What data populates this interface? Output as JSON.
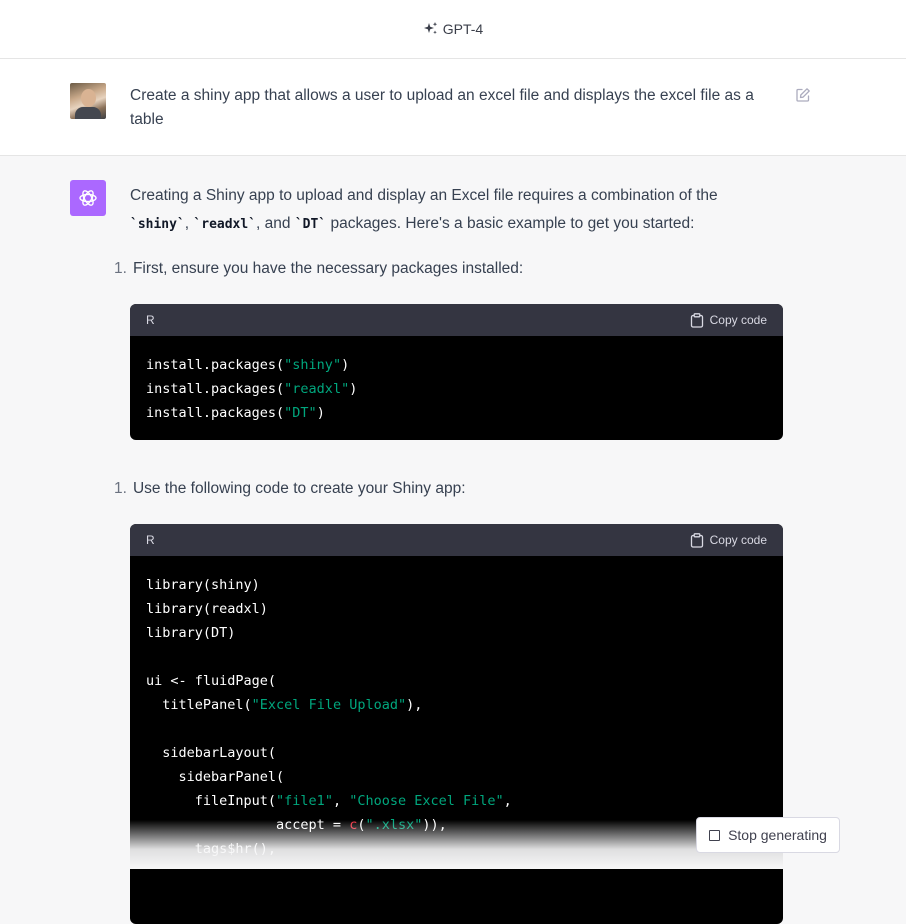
{
  "header": {
    "model_label": "GPT-4",
    "spark_icon": "sparkles-icon"
  },
  "user_message": {
    "text": "Create a shiny app that allows a user to upload an excel file and displays the excel file as a table",
    "edit_icon": "edit-icon"
  },
  "assistant": {
    "intro_line1": "Creating a Shiny app to upload and display an Excel file requires a combination of the",
    "pkg1": "`shiny`",
    "sep1": ", ",
    "pkg2": "`readxl`",
    "sep2": ", and ",
    "pkg3": "`DT`",
    "intro_tail": " packages. Here's a basic example to get you started:",
    "steps": [
      {
        "number": "1.",
        "text": "First, ensure you have the necessary packages installed:"
      },
      {
        "number": "1.",
        "text": "Use the following code to create your Shiny app:"
      }
    ],
    "code_blocks": [
      {
        "language": "R",
        "copy_label": "Copy code",
        "lines": [
          [
            {
              "t": "install.packages(",
              "c": "plain"
            },
            {
              "t": "\"shiny\"",
              "c": "str"
            },
            {
              "t": ")",
              "c": "plain"
            }
          ],
          [
            {
              "t": "install.packages(",
              "c": "plain"
            },
            {
              "t": "\"readxl\"",
              "c": "str"
            },
            {
              "t": ")",
              "c": "plain"
            }
          ],
          [
            {
              "t": "install.packages(",
              "c": "plain"
            },
            {
              "t": "\"DT\"",
              "c": "str"
            },
            {
              "t": ")",
              "c": "plain"
            }
          ]
        ]
      },
      {
        "language": "R",
        "copy_label": "Copy code",
        "lines": [
          [
            {
              "t": "library(shiny)",
              "c": "plain"
            }
          ],
          [
            {
              "t": "library(readxl)",
              "c": "plain"
            }
          ],
          [
            {
              "t": "library(DT)",
              "c": "plain"
            }
          ],
          [
            {
              "t": "",
              "c": "plain"
            }
          ],
          [
            {
              "t": "ui <- fluidPage(",
              "c": "plain"
            }
          ],
          [
            {
              "t": "  titlePanel(",
              "c": "plain"
            },
            {
              "t": "\"Excel File Upload\"",
              "c": "str"
            },
            {
              "t": "),",
              "c": "plain"
            }
          ],
          [
            {
              "t": "",
              "c": "plain"
            }
          ],
          [
            {
              "t": "  sidebarLayout(",
              "c": "plain"
            }
          ],
          [
            {
              "t": "    sidebarPanel(",
              "c": "plain"
            }
          ],
          [
            {
              "t": "      fileInput(",
              "c": "plain"
            },
            {
              "t": "\"file1\"",
              "c": "str"
            },
            {
              "t": ", ",
              "c": "plain"
            },
            {
              "t": "\"Choose Excel File\"",
              "c": "str"
            },
            {
              "t": ",",
              "c": "plain"
            }
          ],
          [
            {
              "t": "                accept = ",
              "c": "plain"
            },
            {
              "t": "c",
              "c": "fn"
            },
            {
              "t": "(",
              "c": "plain"
            },
            {
              "t": "\".xlsx\"",
              "c": "str"
            },
            {
              "t": ")),",
              "c": "plain"
            }
          ],
          [
            {
              "t": "      tags$hr(),",
              "c": "plain"
            }
          ]
        ]
      }
    ]
  },
  "stop_button": {
    "label": "Stop generating"
  }
}
